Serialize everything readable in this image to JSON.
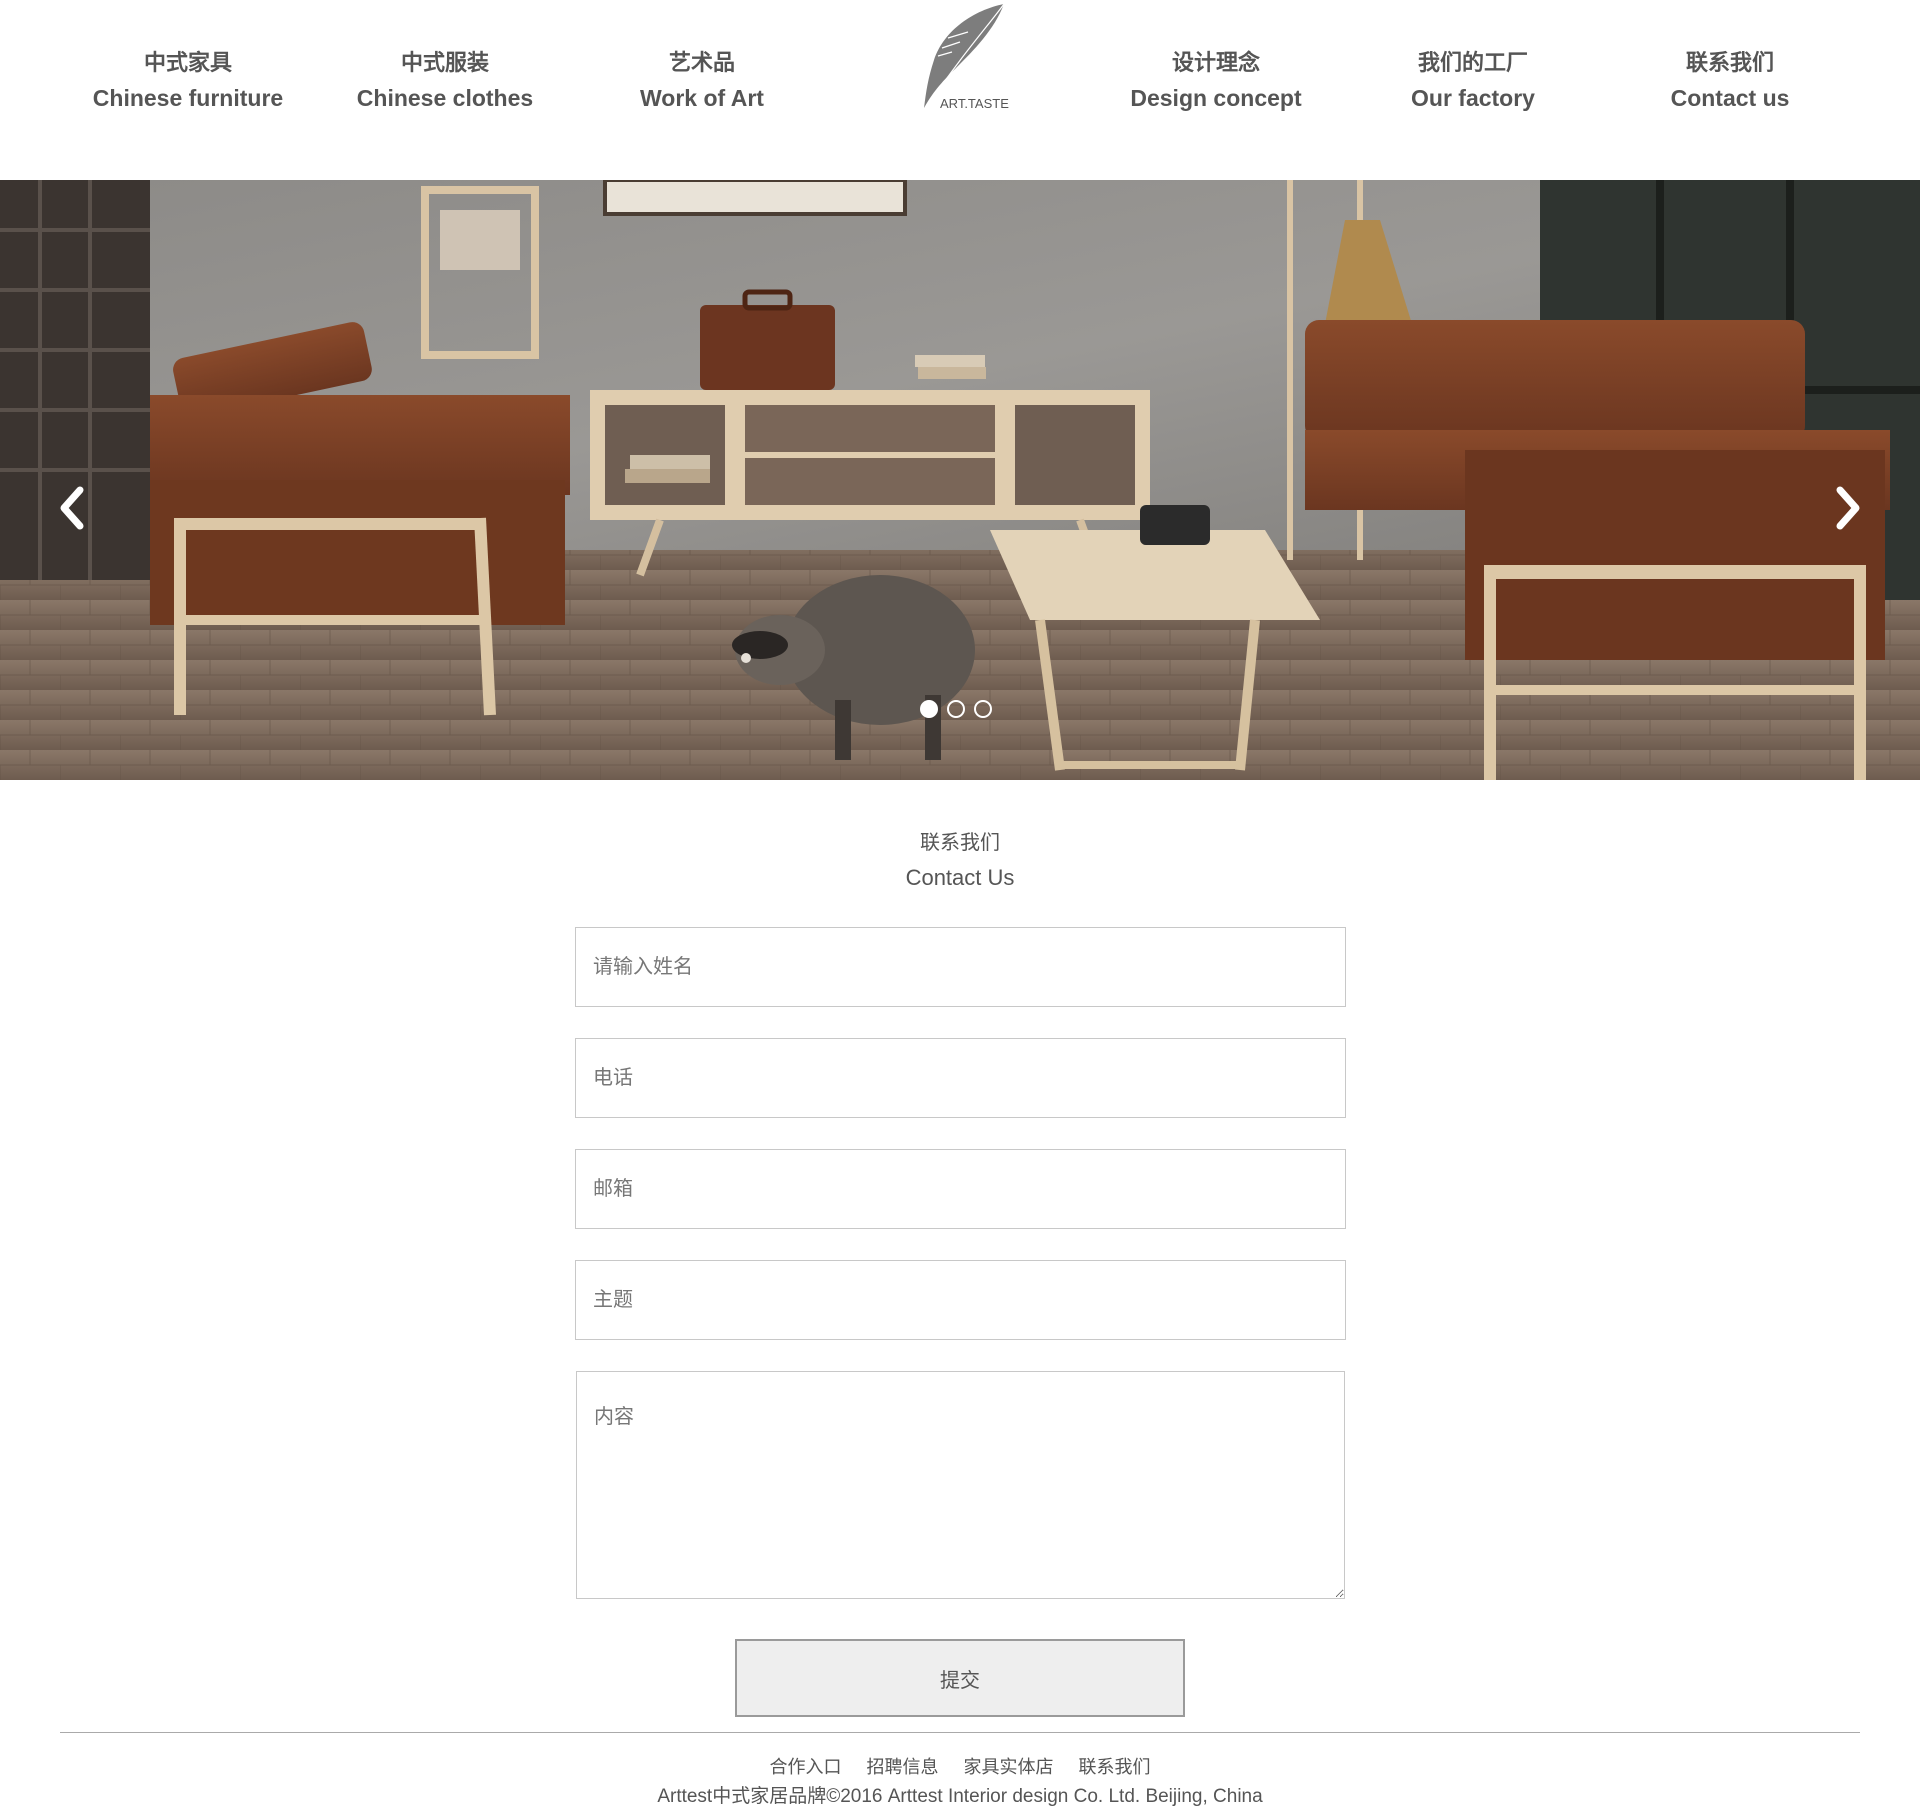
{
  "nav": {
    "items": [
      {
        "cn": "中式家具",
        "en": "Chinese furniture"
      },
      {
        "cn": "中式服装",
        "en": "Chinese clothes"
      },
      {
        "cn": "艺术品",
        "en": "Work of Art"
      },
      {
        "cn": "设计理念",
        "en": "Design concept"
      },
      {
        "cn": "我们的工厂",
        "en": "Our factory"
      },
      {
        "cn": "联系我们",
        "en": "Contact us"
      }
    ],
    "logo_text": "ART.TASTE"
  },
  "banner": {
    "slide_count": 3,
    "active_slide": 1,
    "prev_glyph": "‹",
    "next_glyph": "›"
  },
  "contact": {
    "title_cn": "联系我们",
    "title_en": "Contact Us",
    "name_placeholder": "请输入姓名",
    "phone_placeholder": "电话",
    "email_placeholder": "邮箱",
    "subject_placeholder": "主题",
    "content_placeholder": "内容",
    "submit_label": "提交"
  },
  "footer": {
    "links": [
      "合作入口",
      "招聘信息",
      "家具实体店",
      "联系我们"
    ],
    "copyright": "Arttest中式家居品牌©2016 Arttest Interior design Co. Ltd. Beijing, China"
  },
  "colors": {
    "text": "#555555",
    "border": "#c8c8c8",
    "button_bg": "#eeeeee",
    "sofa": "#7a3f24",
    "wood": "#dcc7a6"
  },
  "icons": {
    "logo": "feather-logo",
    "prev": "chevron-left-icon",
    "next": "chevron-right-icon"
  }
}
